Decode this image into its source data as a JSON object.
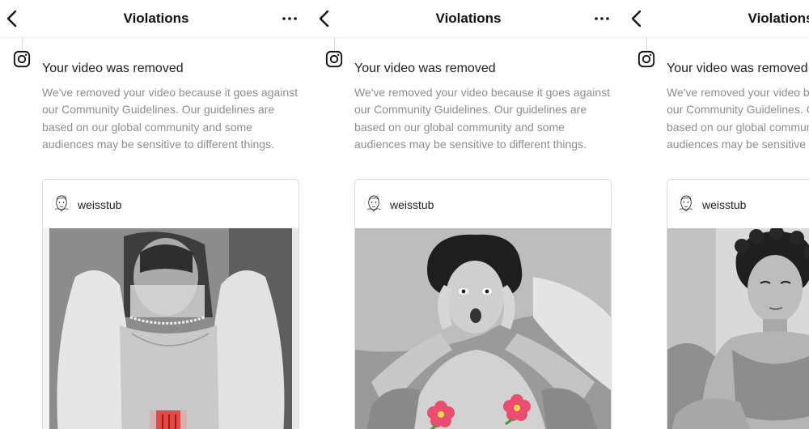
{
  "screens": [
    {
      "header": {
        "title": "Violations",
        "back_icon": "chevron-left-icon",
        "more_icon": "more-horizontal-icon"
      },
      "notice": {
        "icon": "instagram-icon",
        "title": "Your video was removed",
        "body": "We've removed your video because it goes against our Community Guidelines. Our guidelines are based on our global community and some audiences may be sensitive to different things."
      },
      "post": {
        "username": "weisstub",
        "avatar": "sketch-portrait-avatar",
        "media": "black-and-white vintage photo of reclining woman with lace veil, partially censored with red rectangle"
      }
    },
    {
      "header": {
        "title": "Violations",
        "back_icon": "chevron-left-icon",
        "more_icon": "more-horizontal-icon"
      },
      "notice": {
        "icon": "instagram-icon",
        "title": "Your video was removed",
        "body": "We've removed your video because it goes against our Community Guidelines. Our guidelines are based on our global community and some audiences may be sensitive to different things."
      },
      "post": {
        "username": "weisstub",
        "avatar": "sketch-portrait-avatar",
        "media": "black-and-white vintage photo of surprised woman with hands on head, censored with hibiscus flower emoji"
      }
    },
    {
      "header": {
        "title": "Violations",
        "back_icon": "chevron-left-icon",
        "more_icon": "more-horizontal-icon"
      },
      "notice": {
        "icon": "instagram-icon",
        "title": "Your video was removed",
        "body": "We've removed your video because it goes against our Community Guidelines. Our guidelines are based on our global community and some audiences may be sensitive to different things."
      },
      "post": {
        "username": "weisstub",
        "avatar": "sketch-portrait-avatar",
        "media": "black-and-white vintage photo of shirtless curly-haired man"
      }
    }
  ],
  "colors": {
    "secondary_text": "#8e8e8e",
    "border": "#dbdbdb",
    "flower": "#e94d6f",
    "censor_bar": "#d9302f"
  }
}
